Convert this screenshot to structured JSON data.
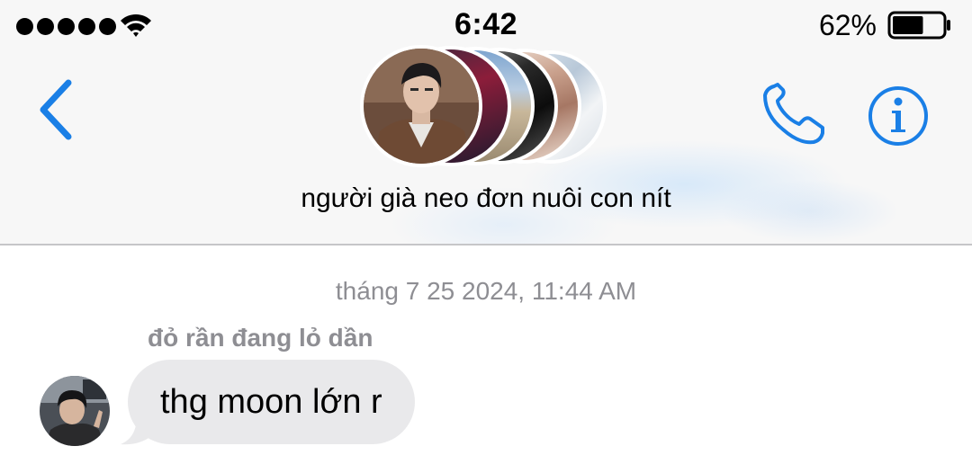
{
  "status_bar": {
    "time": "6:42",
    "battery_percent": "62%",
    "battery_level": 0.62,
    "signal_bars": 5,
    "wifi_icon": "wifi-icon",
    "battery_icon": "battery-icon"
  },
  "nav": {
    "back_icon": "chevron-left-icon",
    "call_icon": "phone-icon",
    "info_icon": "info-icon",
    "group_name": "người già neo đơn nuôi con nít",
    "accent_color": "#1a7fe6"
  },
  "conversation": {
    "timestamp": "tháng 7 25 2024, 11:44 AM",
    "messages": [
      {
        "sender": "đỏ rần đang lỏ dần",
        "text": "thg moon lớn r",
        "bubble_color": "#e9e9eb"
      }
    ]
  }
}
